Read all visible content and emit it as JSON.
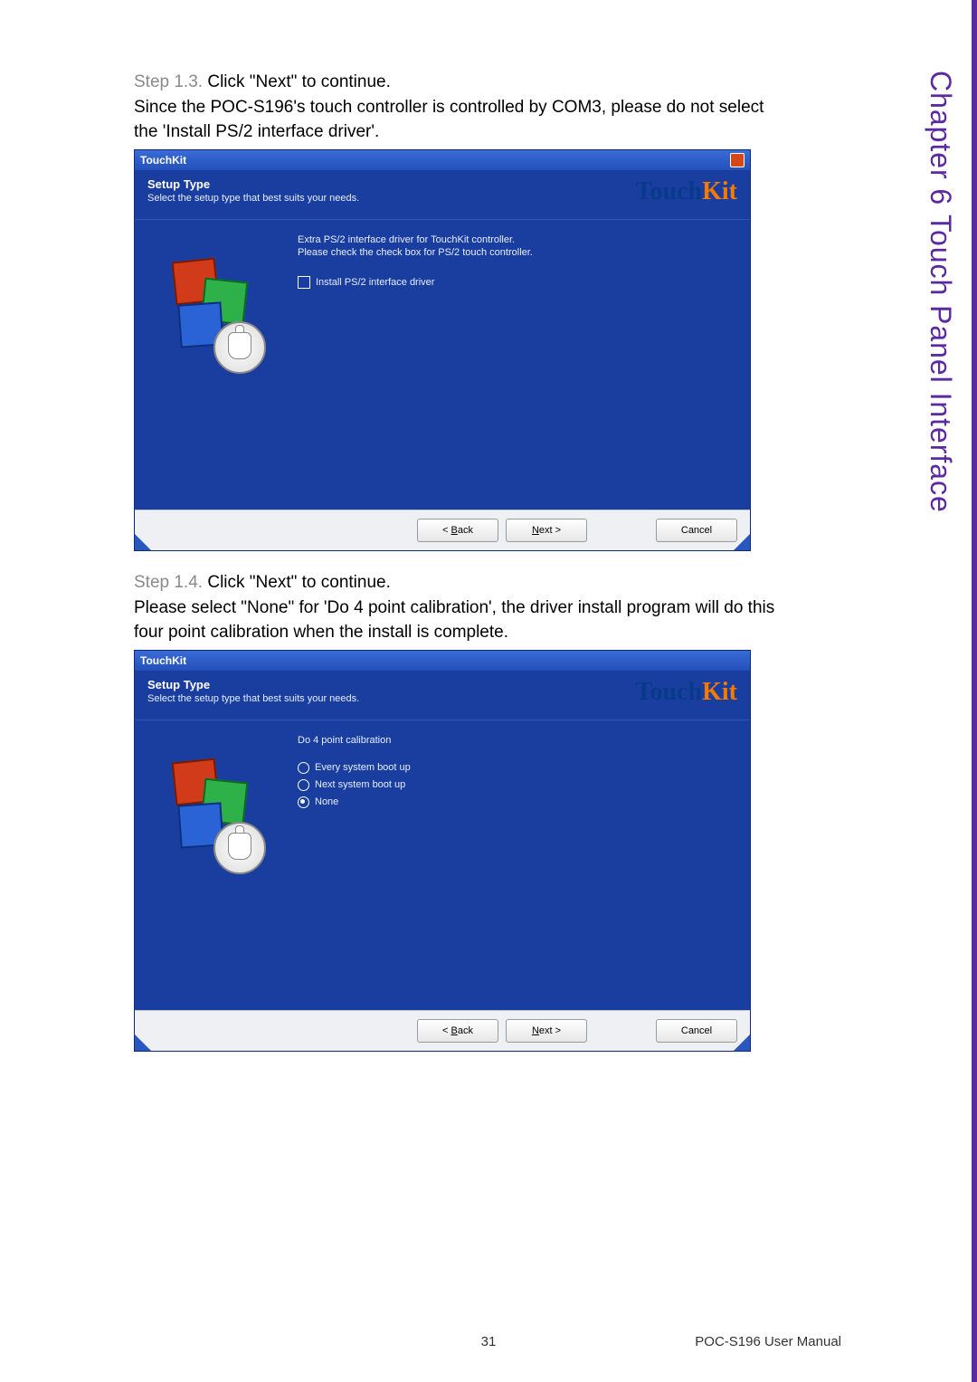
{
  "sideTitle": {
    "chapter": "Chapter 6",
    "section": "Touch Panel Interface"
  },
  "step13": {
    "prefix": "Step 1.3. ",
    "bold": "Click \"Next\" to continue.",
    "line2a": "Since the POC-S196's touch controller is controlled by COM3, please do not select",
    "line2b": "the 'Install PS/2 interface driver'."
  },
  "step14": {
    "prefix": "Step 1.4. ",
    "bold": "Click \"Next\" to continue.",
    "line2a": "Please select \"None\" for 'Do 4 point calibration', the driver install program will do this",
    "line2b": "four point calibration when the install is complete."
  },
  "dialog1": {
    "title": "TouchKit",
    "brand1": "Touch",
    "brand2": "Kit",
    "setupTitle": "Setup Type",
    "setupSub": "Select the setup type that best suits your needs.",
    "info1": "Extra PS/2 interface driver for TouchKit controller.",
    "info2": "Please check the check box for PS/2 touch controller.",
    "checkboxLabel": "Install PS/2 interface driver",
    "btnBack": "< Back",
    "btnNext": "Next >",
    "btnCancel": "Cancel"
  },
  "dialog2": {
    "title": "TouchKit",
    "brand1": "Touch",
    "brand2": "Kit",
    "setupTitle": "Setup Type",
    "setupSub": "Select the setup type that best suits your needs.",
    "heading": "Do 4 point calibration",
    "opt1": "Every system boot up",
    "opt2": "Next system boot up",
    "opt3": "None",
    "btnBack": "< Back",
    "btnNext": "Next >",
    "btnCancel": "Cancel"
  },
  "footer": {
    "pageNum": "31",
    "manual": "POC-S196 User Manual"
  }
}
